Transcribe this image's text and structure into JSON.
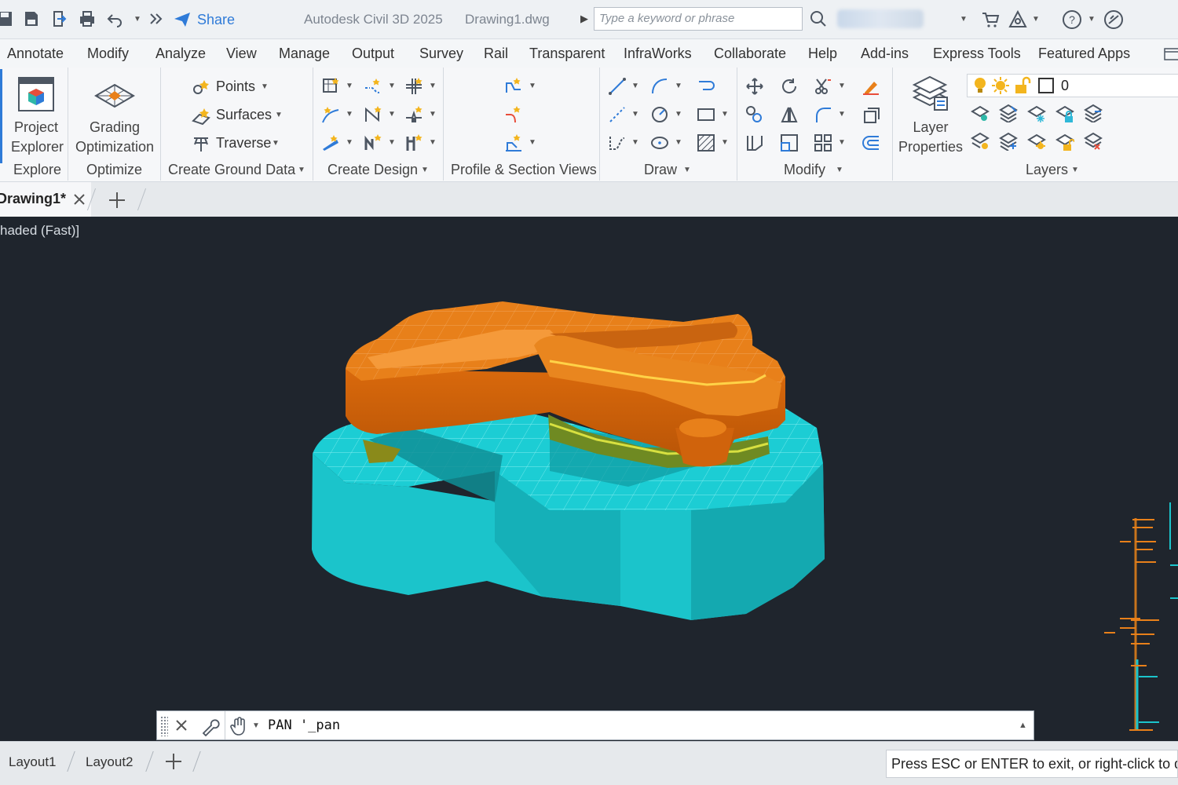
{
  "titlebar": {
    "share_label": "Share",
    "app_title": "Autodesk Civil 3D 2025",
    "file_name": "Drawing1.dwg",
    "search_placeholder": "Type a keyword or phrase"
  },
  "ribbon_tabs": [
    "Annotate",
    "Modify",
    "Analyze",
    "View",
    "Manage",
    "Output",
    "Survey",
    "Rail",
    "Transparent",
    "InfraWorks",
    "Collaborate",
    "Help",
    "Add-ins",
    "Express Tools",
    "Featured Apps"
  ],
  "ribbon": {
    "explore": {
      "button_line1": "Project",
      "button_line2": "Explorer",
      "title": "Explore"
    },
    "optimize": {
      "button_line1": "Grading",
      "button_line2": "Optimization",
      "title": "Optimize"
    },
    "ground": {
      "points": "Points",
      "surfaces": "Surfaces",
      "traverse": "Traverse",
      "title": "Create Ground Data"
    },
    "design": {
      "title": "Create Design"
    },
    "profile": {
      "title": "Profile & Section Views"
    },
    "draw": {
      "title": "Draw"
    },
    "modify": {
      "title": "Modify"
    },
    "layers": {
      "button_line1": "Layer",
      "button_line2": "Properties",
      "current_layer": "0",
      "title": "Layers"
    }
  },
  "file_tabs": {
    "active": "Drawing1*"
  },
  "viewport": {
    "visual_style_label": "haded (Fast)]",
    "colors": {
      "background": "#1f252d",
      "base_solid": "#17c8cf",
      "top_solid": "#e8801a"
    }
  },
  "command_line": {
    "text": "PAN '_pan"
  },
  "statusbar": {
    "layout_tabs": [
      "Layout1",
      "Layout2"
    ],
    "message": "Press ESC or ENTER to exit, or right-click to d"
  }
}
